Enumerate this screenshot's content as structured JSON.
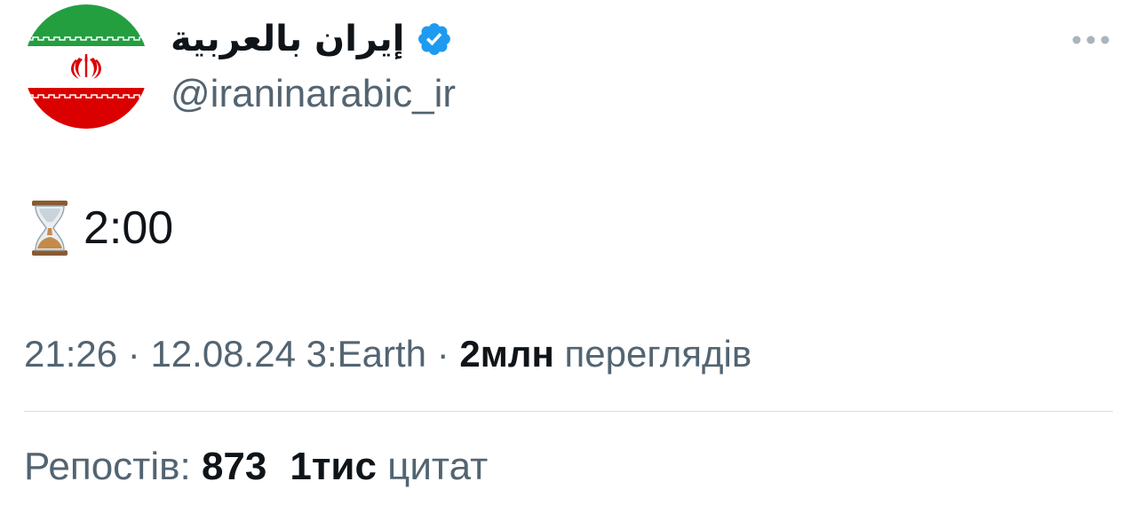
{
  "author": {
    "display_name": "إيران بالعربية",
    "handle": "@iraninarabic_ir",
    "verified": true,
    "avatar_icon": "iran-flag-avatar",
    "avatar_colors": {
      "green": "#239f40",
      "white": "#ffffff",
      "red": "#da0000"
    }
  },
  "more_icon": "more-dots-icon",
  "tweet": {
    "emoji_icon": "hourglass-icon",
    "text": "2:00"
  },
  "meta": {
    "time": "21:26",
    "separator1": " · ",
    "date": "12.08.24",
    "location": "3:Earth",
    "separator2": " · ",
    "views_count": "2млн",
    "views_label": "переглядів"
  },
  "stats": {
    "reposts_label": "Репостів:",
    "reposts_count": "873",
    "quotes_count": "1тис",
    "quotes_label": "цитат"
  },
  "colors": {
    "text_primary": "#0f1419",
    "text_secondary": "#536471",
    "verified_blue": "#1d9bf0",
    "divider": "#d9dee2"
  }
}
